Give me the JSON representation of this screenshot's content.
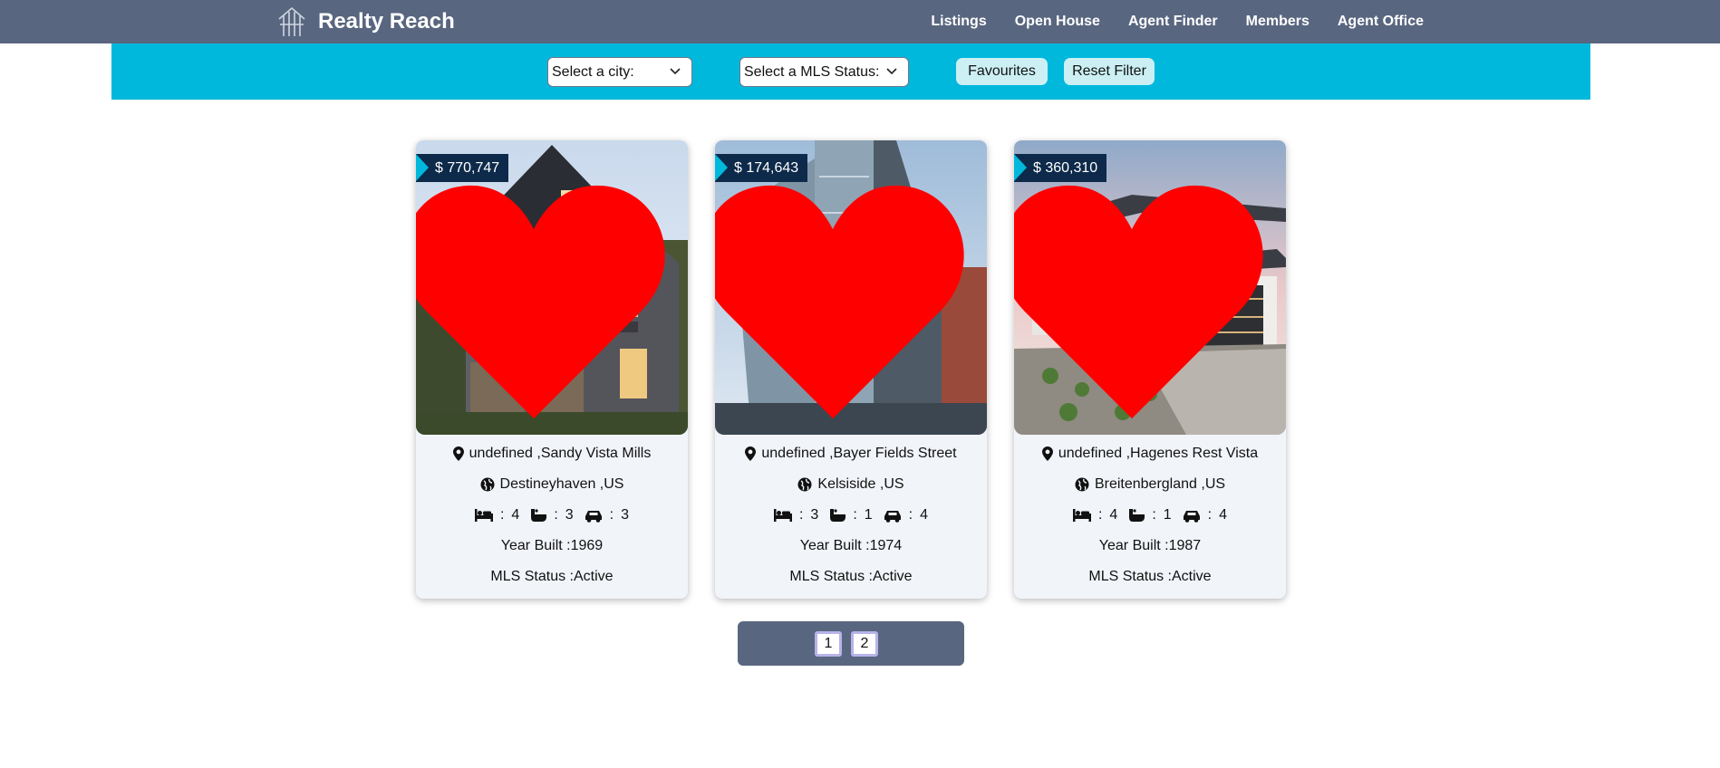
{
  "brand": {
    "name": "Realty Reach",
    "logo_icon": "building-logo-icon"
  },
  "nav": {
    "items": [
      "Listings",
      "Open House",
      "Agent Finder",
      "Members",
      "Agent Office"
    ]
  },
  "filters": {
    "city_select": "Select a city:",
    "status_select": "Select a MLS Status:",
    "favourites_label": "Favourites",
    "reset_label": "Reset Filter"
  },
  "listings": [
    {
      "price": "$ 770,747",
      "address": "undefined ,Sandy Vista Mills",
      "location": "Destineyhaven ,US",
      "beds": "4",
      "baths": "3",
      "garage": "3",
      "year_built": "Year Built :1969",
      "mls_status": "MLS Status :Active",
      "favourite": true
    },
    {
      "price": "$ 174,643",
      "address": "undefined ,Bayer Fields Street",
      "location": "Kelsiside ,US",
      "beds": "3",
      "baths": "1",
      "garage": "4",
      "year_built": "Year Built :1974",
      "mls_status": "MLS Status :Active",
      "favourite": true
    },
    {
      "price": "$ 360,310",
      "address": "undefined ,Hagenes Rest Vista",
      "location": "Breitenbergland ,US",
      "beds": "4",
      "baths": "1",
      "garage": "4",
      "year_built": "Year Built :1987",
      "mls_status": "MLS Status :Active",
      "favourite": true
    }
  ],
  "pagination": {
    "pages": [
      "1",
      "2"
    ]
  },
  "colors": {
    "nav": "#59667f",
    "filterbar": "#00b8dc",
    "price_tag": "#0d2a4a",
    "heart": "#ff0000",
    "card_bg": "#f1f4f9"
  }
}
